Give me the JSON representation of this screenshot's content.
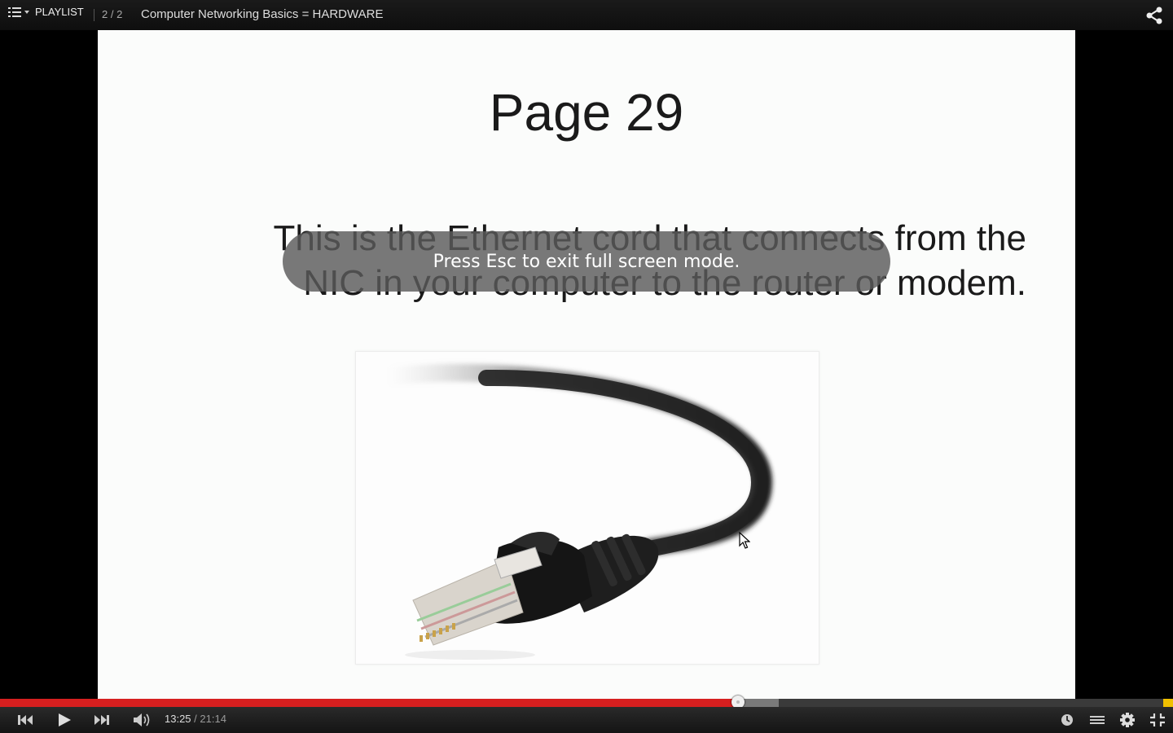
{
  "topbar": {
    "playlist_label": "PLAYLIST",
    "counter": "2 / 2",
    "title": "Computer Networking Basics = HARDWARE"
  },
  "slide": {
    "title": "Page 29",
    "body_line1": "This is the Ethernet cord that connects from the",
    "body_line2": "NIC in your computer to the router or modem."
  },
  "overlay": {
    "message": "Press Esc to exit full screen mode."
  },
  "player": {
    "current_time": "13:25",
    "separator": " / ",
    "duration": "21:14",
    "progress_played_fraction": 0.629,
    "progress_buffered_fraction": 0.664
  },
  "icons": {
    "menu": "list-icon",
    "share": "share-icon",
    "previous": "skip-previous-icon",
    "play": "play-icon",
    "next": "skip-next-icon",
    "volume": "volume-icon",
    "watch_later": "clock-icon",
    "transcript": "captions-icon",
    "settings": "gear-icon",
    "exit_fullscreen": "exit-fullscreen-icon"
  },
  "colors": {
    "played": "#d61f1f",
    "end_marker": "#f0c000"
  }
}
